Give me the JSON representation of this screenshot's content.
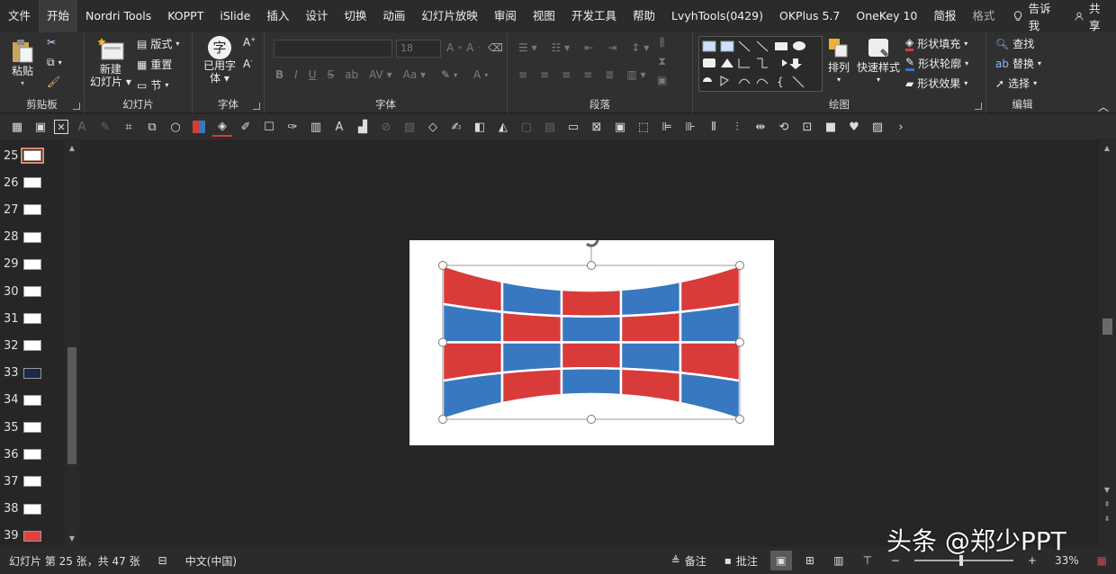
{
  "tabs": [
    {
      "label": "文件"
    },
    {
      "label": "开始",
      "active": true
    },
    {
      "label": "Nordri Tools"
    },
    {
      "label": "KOPPT"
    },
    {
      "label": "iSlide"
    },
    {
      "label": "插入"
    },
    {
      "label": "设计"
    },
    {
      "label": "切换"
    },
    {
      "label": "动画"
    },
    {
      "label": "幻灯片放映"
    },
    {
      "label": "审阅"
    },
    {
      "label": "视图"
    },
    {
      "label": "开发工具"
    },
    {
      "label": "帮助"
    },
    {
      "label": "LvyhTools(0429)"
    },
    {
      "label": "OKPlus 5.7"
    },
    {
      "label": "OneKey 10"
    },
    {
      "label": "简报"
    },
    {
      "label": "格式"
    }
  ],
  "tellme": "告诉我",
  "share": "共享",
  "ribbon": {
    "clipboard": {
      "label": "剪贴板",
      "paste": "粘贴"
    },
    "slides": {
      "label": "幻灯片",
      "new_slide": "新建",
      "new_slide2": "幻灯片",
      "layout": "版式",
      "reset": "重置",
      "section": "节"
    },
    "font_small": {
      "label": "字体",
      "common_font": "已用字",
      "common_font2": "体",
      "char": "字"
    },
    "font": {
      "label": "字体",
      "size": "18"
    },
    "paragraph": {
      "label": "段落"
    },
    "drawing": {
      "label": "绘图",
      "arrange": "排列",
      "quick_styles": "快速样式",
      "fill": "形状填充",
      "outline": "形状轮廓",
      "effects": "形状效果"
    },
    "editing": {
      "label": "编辑",
      "find": "查找",
      "replace": "替换",
      "select": "选择"
    }
  },
  "thumbnails": [
    {
      "num": "25",
      "selected": true,
      "color": "#ffffff"
    },
    {
      "num": "26",
      "color": "#ffffff"
    },
    {
      "num": "27",
      "color": "#ffffff"
    },
    {
      "num": "28",
      "color": "#ffffff"
    },
    {
      "num": "29",
      "color": "#ffffff"
    },
    {
      "num": "30",
      "color": "#ffffff"
    },
    {
      "num": "31",
      "color": "#ffffff"
    },
    {
      "num": "32",
      "color": "#ffffff"
    },
    {
      "num": "33",
      "color": "#1a2a44"
    },
    {
      "num": "34",
      "color": "#ffffff"
    },
    {
      "num": "35",
      "color": "#ffffff"
    },
    {
      "num": "36",
      "color": "#ffffff"
    },
    {
      "num": "37",
      "color": "#ffffff"
    },
    {
      "num": "38",
      "color": "#ffffff"
    },
    {
      "num": "39",
      "color": "#e04040"
    }
  ],
  "status": {
    "slide_info": "幻灯片 第 25 张，共 47 张",
    "language": "中文(中国)",
    "notes": "备注",
    "comments": "批注",
    "zoom": "33%"
  },
  "watermark": "头条 @郑少PPT",
  "colors": {
    "red": "#d93a3a",
    "blue": "#3878c0",
    "accent": "#e0896a"
  }
}
